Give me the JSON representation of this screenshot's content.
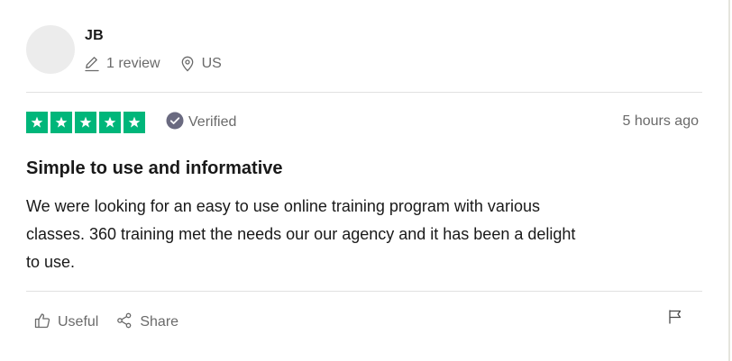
{
  "reviewer": {
    "name": "JB",
    "review_count": "1 review",
    "country": "US"
  },
  "rating": {
    "stars": 5,
    "max": 5,
    "color": "#00b67a"
  },
  "verified_label": "Verified",
  "date": "5 hours ago",
  "review": {
    "title": "Simple to use and informative",
    "body_lines": [
      "We were looking for an easy to use online training program with various",
      "classes. 360 training met the needs our our agency and it has been a delight",
      "to use."
    ]
  },
  "actions": {
    "useful_label": "Useful",
    "share_label": "Share"
  },
  "icons": {
    "avatar": "avatar-placeholder",
    "review_count": "pencil-icon",
    "country": "location-pin-icon",
    "verified": "check-circle-icon",
    "useful": "thumbs-up-icon",
    "share": "share-icon",
    "report": "flag-icon"
  }
}
